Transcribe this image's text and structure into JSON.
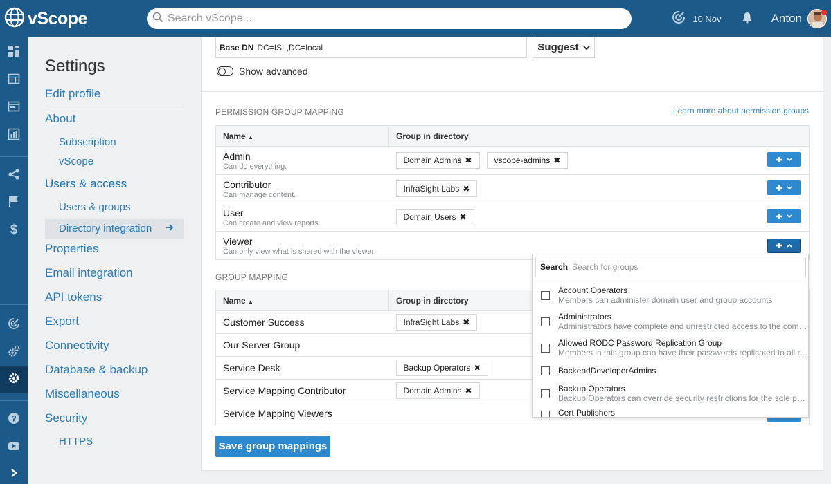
{
  "brand": {
    "name": "vScope"
  },
  "search": {
    "placeholder": "Search vScope..."
  },
  "header": {
    "date": "10 Nov",
    "user": "Anton"
  },
  "sidebar": {
    "title": "Settings",
    "items": [
      {
        "label": "Edit profile"
      },
      {
        "label": "About"
      },
      {
        "label": "Subscription"
      },
      {
        "label": "vScope"
      },
      {
        "label": "Users & access"
      },
      {
        "label": "Users & groups"
      },
      {
        "label": "Directory integration"
      },
      {
        "label": "Properties"
      },
      {
        "label": "Email integration"
      },
      {
        "label": "API tokens"
      },
      {
        "label": "Export"
      },
      {
        "label": "Connectivity"
      },
      {
        "label": "Database & backup"
      },
      {
        "label": "Miscellaneous"
      },
      {
        "label": "Security"
      },
      {
        "label": "HTTPS"
      }
    ]
  },
  "ldap": {
    "base_dn_label": "Base DN",
    "base_dn_value": "DC=ISL,DC=local",
    "suggest_label": "Suggest",
    "show_advanced": "Show advanced"
  },
  "permission": {
    "section_label": "PERMISSION GROUP MAPPING",
    "learn_more": "Learn more about permission groups",
    "col_name": "Name",
    "col_group": "Group in directory",
    "rows": [
      {
        "name": "Admin",
        "desc": "Can do everything.",
        "groups": [
          "Domain Admins",
          "vscope-admins"
        ]
      },
      {
        "name": "Contributor",
        "desc": "Can manage content.",
        "groups": [
          "InfraSight Labs"
        ]
      },
      {
        "name": "User",
        "desc": "Can create and view reports.",
        "groups": [
          "Domain Users"
        ]
      },
      {
        "name": "Viewer",
        "desc": "Can only view what is shared with the viewer.",
        "groups": []
      }
    ]
  },
  "group_mapping": {
    "section_label": "GROUP MAPPING",
    "col_name": "Name",
    "col_group": "Group in directory",
    "rows": [
      {
        "name": "Customer Success",
        "groups": [
          "InfraSight Labs"
        ]
      },
      {
        "name": "Our Server Group",
        "groups": []
      },
      {
        "name": "Service Desk",
        "groups": [
          "Backup Operators"
        ]
      },
      {
        "name": "Service Mapping Contributor",
        "groups": [
          "Domain Admins"
        ]
      },
      {
        "name": "Service Mapping Viewers",
        "groups": []
      }
    ]
  },
  "save_label": "Save group mappings",
  "dropdown": {
    "search_label": "Search",
    "search_placeholder": "Search for groups",
    "items": [
      {
        "name": "Account Operators",
        "desc": "Members can administer domain user and group accounts"
      },
      {
        "name": "Administrators",
        "desc": "Administrators have complete and unrestricted access to the computer/domain"
      },
      {
        "name": "Allowed RODC Password Replication Group",
        "desc": "Members in this group can have their passwords replicated to all read-only domain controllers"
      },
      {
        "name": "BackendDeveloperAdmins",
        "desc": ""
      },
      {
        "name": "Backup Operators",
        "desc": "Backup Operators can override security restrictions for the sole purpose of backing up or restoring files"
      },
      {
        "name": "Cert Publishers",
        "desc": ""
      }
    ]
  },
  "colors": {
    "brand": "#1c5a8a",
    "accent": "#2e8ad0",
    "link": "#2e7cb5"
  }
}
